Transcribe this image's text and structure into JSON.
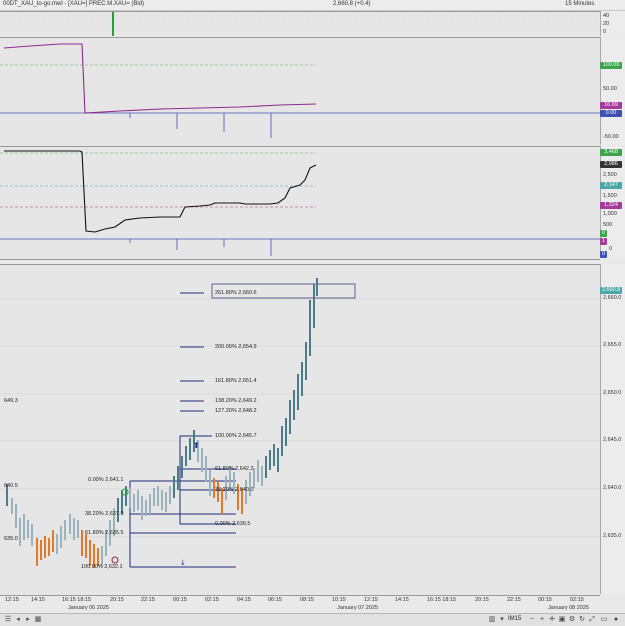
{
  "window": {
    "title": "00DT_XAU_to-go.mwl - [XAU=] PREC.M.XAU= (Bid)",
    "price_status": "2,660.8 (+0.4)",
    "interval": "15 Minutes"
  },
  "panel1": {
    "ticks": [
      "40",
      "20",
      "0"
    ]
  },
  "panel2": {
    "ticks": [
      "50.00",
      "-50.00"
    ],
    "badges": [
      {
        "text": "100.00",
        "color": "#3aa54a"
      },
      {
        "text": "16.69",
        "color": "#a43b9a"
      },
      {
        "text": "0.00",
        "color": "#3f51b5"
      }
    ]
  },
  "panel3": {
    "ticks": [
      "2,500",
      "1,500",
      "1,000",
      "500",
      "0"
    ],
    "badges": [
      {
        "text": "3,468",
        "color": "#3aa54a"
      },
      {
        "text": "2,986",
        "color": "#333333"
      },
      {
        "text": "2,147",
        "color": "#4aa8a8"
      },
      {
        "text": "1,324",
        "color": "#a43b9a"
      },
      {
        "text": "0",
        "color": "#3aa54a"
      },
      {
        "text": "1",
        "color": "#a43b9a"
      },
      {
        "text": "0",
        "color": "#3f51b5"
      }
    ]
  },
  "price_panel": {
    "last_price": "2,660.8",
    "ticks": [
      "2,660.0",
      "2,655.0",
      "2,650.0",
      "2,645.0",
      "2,640.0",
      "2,635.0"
    ],
    "left_labels": [
      "649.3",
      "640.5",
      "635.0"
    ],
    "fib_labels": [
      "261.80% 2,660.6",
      "200.00% 2,654.9",
      "161.80% 2,651.4",
      "138.20% 2,649.2",
      "127.20% 2,648.2",
      "100.00% 2,645.7",
      "61.80% 2,642.2",
      "38.20% 2,640.0",
      "0.00% 2,636.5",
      "0.00% 2,641.1",
      "38.20% 2,637.9",
      "61.80% 2,635.5",
      "100.00% 2,632.1"
    ]
  },
  "time_axis": {
    "labels": [
      "12:15",
      "14:15",
      "16:15 18:15",
      "20:15",
      "22:15",
      "00:15",
      "02:15",
      "04:15",
      "06:15",
      "08:15",
      "10:15",
      "12:15",
      "14:15",
      "16:15 18:15",
      "20:15",
      "22:15",
      "00:15",
      "02:15"
    ],
    "dates": [
      "January 06 2025",
      "January 07 2025",
      "January 08 2025"
    ]
  },
  "toolbar": {
    "timeframe": "IM15"
  }
}
